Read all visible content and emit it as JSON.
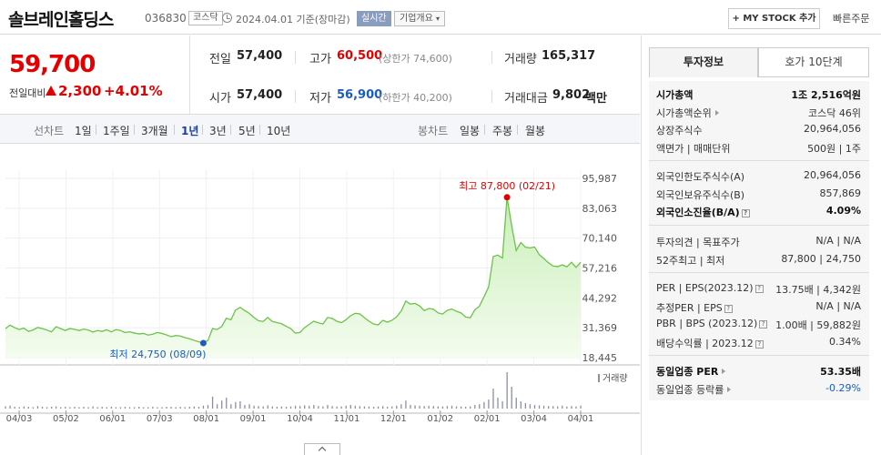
{
  "header": {
    "stock_name": "솔브레인홀딩스",
    "stock_code": "036830",
    "market": "코스닥",
    "date_text": "2024.04.01  기준(장마감)",
    "realtime_label": "실시간",
    "overview_label": "기업개요",
    "mystock_label": "+ MY STOCK 추가",
    "quick_order_label": "빠른주문"
  },
  "price": {
    "current": "59,700",
    "change_label": "전일대비",
    "change_value": "2,300",
    "change_pct": "+4.01%",
    "direction": "up",
    "up_color": "#e40000",
    "down_color": "#1b5dbe"
  },
  "stats": {
    "prev_close_label": "전일",
    "prev_close": "57,400",
    "open_label": "시가",
    "open": "57,400",
    "high_label": "고가",
    "high": "60,500",
    "upper_limit": "(상한가 74,600)",
    "low_label": "저가",
    "low": "56,900",
    "lower_limit": "(하한가 40,200)",
    "volume_label": "거래량",
    "volume": "165,317",
    "amount_label": "거래대금",
    "amount": "9,802",
    "amount_unit": "백만"
  },
  "period_bar": {
    "line_chart_label": "선차트",
    "line_periods": [
      "1일",
      "1주일",
      "3개월",
      "1년",
      "3년",
      "5년",
      "10년"
    ],
    "active_period": "1년",
    "candle_chart_label": "봉차트",
    "candle_periods": [
      "일봉",
      "주봉",
      "월봉"
    ]
  },
  "chart_data": {
    "type": "area",
    "x_tick_labels": [
      "04/03",
      "05/02",
      "06/01",
      "07/03",
      "08/01",
      "09/01",
      "10/04",
      "11/01",
      "12/01",
      "01/02",
      "02/01",
      "03/04",
      "04/01"
    ],
    "y_tick_labels": [
      "95,987",
      "83,063",
      "70,140",
      "57,216",
      "44,292",
      "31,369",
      "18,445"
    ],
    "ylim": [
      18445,
      95987
    ],
    "high_annotation": "최고 87,800 (02/21)",
    "low_annotation": "최저 24,750 (08/09)",
    "volume_legend": "거래량",
    "line_color": "#6cc24a",
    "fill_color": "#c9efb8",
    "series": [
      {
        "values": [
          31000,
          32500,
          31400,
          30600,
          31200,
          29800,
          30400,
          31500,
          31000,
          30400,
          29600,
          31800,
          31000,
          30200,
          31000,
          30700,
          30200,
          30800,
          30400,
          29500,
          30200,
          29800,
          30500,
          29600,
          30600,
          30200,
          29300,
          29600,
          29100,
          28700,
          28900,
          28200,
          28600,
          29300,
          28900,
          28300,
          27500,
          28000,
          27800,
          27100,
          26600,
          25900,
          25300,
          24750,
          25900,
          31000,
          30600,
          31900,
          35500,
          34800,
          39000,
          40200,
          38800,
          37600,
          35800,
          34400,
          34100,
          35800,
          34100,
          33600,
          33100,
          32000,
          31000,
          29000,
          29300,
          31400,
          32800,
          34200,
          33500,
          33000,
          35800,
          35400,
          34200,
          33600,
          34800,
          36600,
          37600,
          37400,
          35700,
          34200,
          33000,
          32600,
          34600,
          33800,
          34600,
          36100,
          38600,
          42900,
          41600,
          41900,
          40800,
          38800,
          39700,
          39400,
          37800,
          37300,
          38900,
          39500,
          38500,
          37800,
          36000,
          35700,
          39100,
          40700,
          44800,
          49000,
          62200,
          62800,
          61500,
          87800,
          75600,
          64800,
          68200,
          66200,
          65900,
          66300,
          63000,
          61300,
          59500,
          58100,
          57800,
          58600,
          57700,
          59700,
          57500,
          59700
        ],
        "volume": [
          0.06,
          0.08,
          0.05,
          0.04,
          0.06,
          0.05,
          0.04,
          0.07,
          0.05,
          0.04,
          0.05,
          0.06,
          0.04,
          0.05,
          0.04,
          0.05,
          0.04,
          0.05,
          0.04,
          0.06,
          0.04,
          0.05,
          0.04,
          0.05,
          0.04,
          0.04,
          0.05,
          0.04,
          0.04,
          0.05,
          0.04,
          0.04,
          0.05,
          0.04,
          0.04,
          0.05,
          0.05,
          0.04,
          0.05,
          0.04,
          0.05,
          0.06,
          0.05,
          0.08,
          0.1,
          0.33,
          0.12,
          0.22,
          0.3,
          0.12,
          0.18,
          0.2,
          0.1,
          0.12,
          0.08,
          0.07,
          0.06,
          0.09,
          0.06,
          0.05,
          0.06,
          0.05,
          0.06,
          0.08,
          0.07,
          0.09,
          0.08,
          0.1,
          0.07,
          0.06,
          0.1,
          0.07,
          0.06,
          0.06,
          0.08,
          0.1,
          0.08,
          0.07,
          0.06,
          0.06,
          0.05,
          0.06,
          0.07,
          0.05,
          0.06,
          0.08,
          0.12,
          0.22,
          0.1,
          0.09,
          0.08,
          0.07,
          0.08,
          0.07,
          0.06,
          0.06,
          0.07,
          0.08,
          0.06,
          0.06,
          0.05,
          0.06,
          0.1,
          0.12,
          0.18,
          0.25,
          0.55,
          0.3,
          0.2,
          1.0,
          0.6,
          0.3,
          0.2,
          0.15,
          0.12,
          0.1,
          0.09,
          0.08,
          0.07,
          0.07,
          0.06,
          0.08,
          0.06,
          0.07,
          0.06,
          0.08
        ]
      }
    ]
  },
  "right_panel": {
    "tabs": [
      "투자정보",
      "호가 10단계"
    ],
    "rows_group1": [
      {
        "label": "시가총액",
        "value": "1조 2,516억원",
        "bold": true
      },
      {
        "label": "시가총액순위",
        "value": "코스닥 46위",
        "arrow": true
      },
      {
        "label": "상장주식수",
        "value": "20,964,056"
      },
      {
        "label": "액면가 | 매매단위",
        "value": "500원 | 1주"
      }
    ],
    "rows_group2": [
      {
        "label": "외국인한도주식수(A)",
        "value": "20,964,056"
      },
      {
        "label": "외국인보유주식수(B)",
        "value": "857,869"
      },
      {
        "label": "외국인소진율(B/A)",
        "value": "4.09%",
        "bold": true,
        "help": true
      }
    ],
    "rows_group3": [
      {
        "label": "투자의견 | 목표주가",
        "value": "N/A | N/A"
      },
      {
        "label": "52주최고 | 최저",
        "value": "87,800 | 24,750"
      }
    ],
    "rows_group4": [
      {
        "label": "PER | EPS(2023.12)",
        "help": true,
        "value": "13.75배 | 4,342원"
      },
      {
        "label": "추정PER | EPS",
        "help": true,
        "value": "N/A | N/A"
      },
      {
        "label": "PBR | BPS (2023.12)",
        "help": true,
        "value": "1.00배 | 59,882원"
      },
      {
        "label": "배당수익률 | 2023.12",
        "help": true,
        "value": "0.34%"
      }
    ],
    "rows_group5": [
      {
        "label": "동일업종 PER",
        "value": "53.35배",
        "bold": true,
        "arrow": true
      },
      {
        "label": "동일업종 등락률",
        "value": "-0.29%",
        "arrow": true,
        "negative": true
      }
    ]
  }
}
